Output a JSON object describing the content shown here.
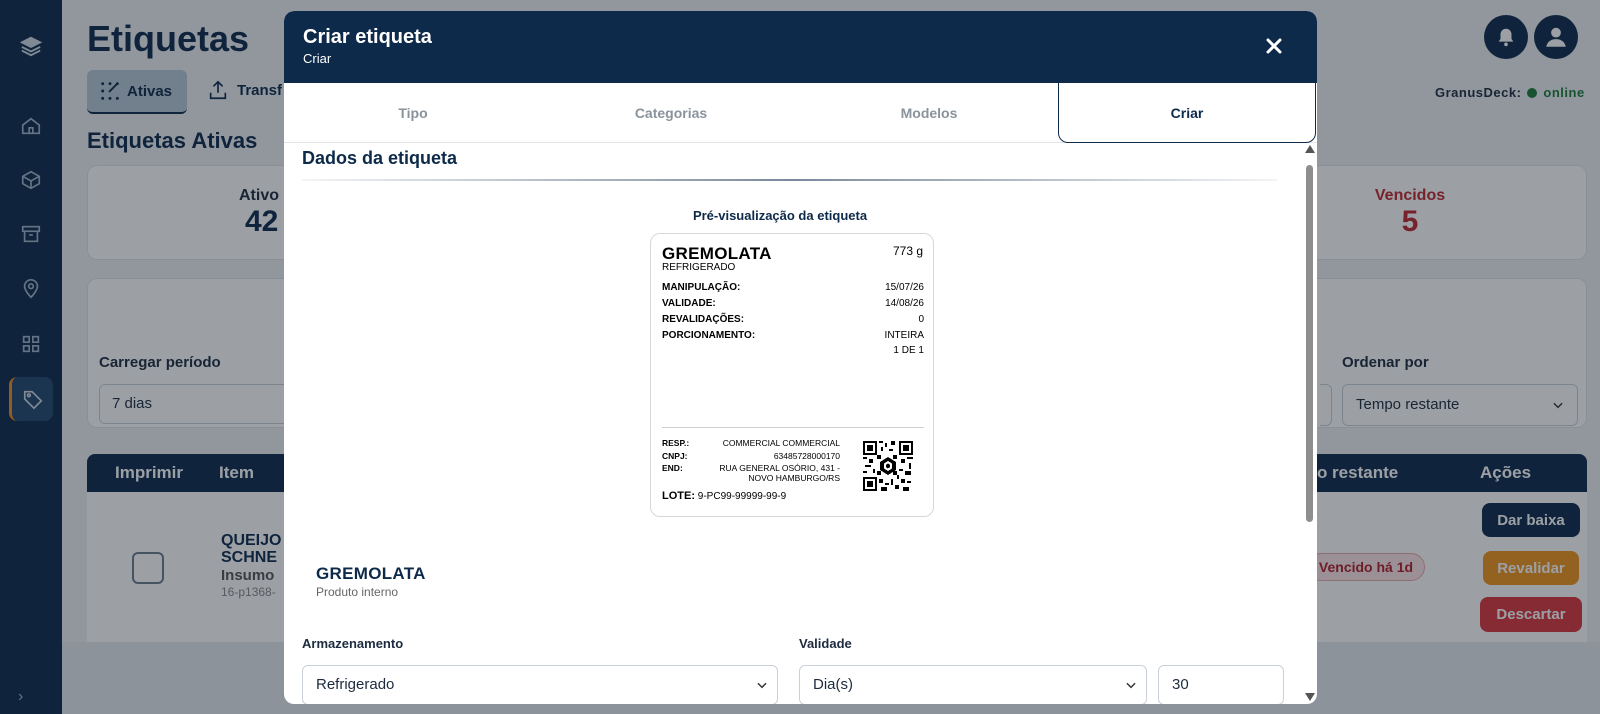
{
  "background": {
    "page_title": "Etiquetas",
    "tabs": {
      "ativas": "Ativas",
      "transferencias": "Transf"
    },
    "section_title": "Etiquetas Ativas",
    "deck_status": {
      "label": "GranusDeck:",
      "status": "online"
    },
    "stats": {
      "ativos_label": "Ativo",
      "ativos_value": "42",
      "vencidos_label": "Vencidos",
      "vencidos_value": "5"
    },
    "filters": {
      "periodo_label": "Carregar período",
      "periodo_value": "7 dias",
      "ordenar_label": "Ordenar por",
      "ordenar_value": "Tempo restante"
    },
    "table_headers": {
      "imprimir": "Imprimir",
      "item": "Item",
      "tempo_restante": "empo restante",
      "acoes": "Ações"
    },
    "row": {
      "name_line1": "QUEIJO",
      "name_line2": "SCHNE",
      "type": "Insumo",
      "code": "16-p1368-",
      "badge": "Vencido há 1d"
    },
    "actions": {
      "dar_baixa": "Dar baixa",
      "revalidar": "Revalidar",
      "descartar": "Descartar"
    }
  },
  "modal": {
    "title": "Criar etiqueta",
    "subtitle": "Criar",
    "tabs": [
      "Tipo",
      "Categorias",
      "Modelos",
      "Criar"
    ],
    "active_tab": "Criar",
    "section_title": "Dados da etiqueta",
    "preview_title": "Pré-visualização da etiqueta",
    "label_preview": {
      "name": "GREMOLATA",
      "weight": "773 g",
      "storage": "REFRIGERADO",
      "rows": [
        {
          "key": "MANIPULAÇÃO:",
          "value": "15/07/26"
        },
        {
          "key": "VALIDADE:",
          "value": "14/08/26"
        },
        {
          "key": "REVALIDAÇÕES:",
          "value": "0"
        },
        {
          "key": "PORCIONAMENTO:",
          "value": "INTEIRA"
        }
      ],
      "portion": "1 DE 1",
      "resp_key": "RESP.:",
      "resp_value": "COMMERCIAL COMMERCIAL",
      "cnpj_key": "CNPJ:",
      "cnpj_value": "63485728000170",
      "end_key": "END:",
      "end_line1": "RUA GENERAL OSÓRIO, 431 -",
      "end_line2": "NOVO HAMBURGO/RS",
      "lote_key": "LOTE:",
      "lote_value": "9-PC99-99999-99-9"
    },
    "product": {
      "name": "GREMOLATA",
      "type": "Produto interno"
    },
    "armazenamento": {
      "label": "Armazenamento",
      "value": "Refrigerado"
    },
    "validade": {
      "label": "Validade",
      "unit": "Dia(s)",
      "amount": "30"
    }
  },
  "colors": {
    "primary": "#0d2a4a",
    "danger": "#d9343c",
    "warning": "#f0941d",
    "online": "#1b7a37"
  }
}
